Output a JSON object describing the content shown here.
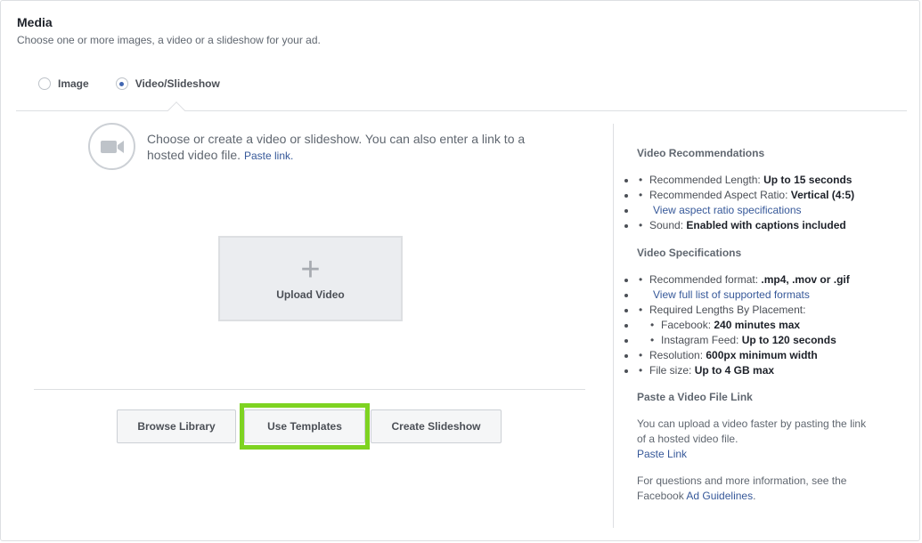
{
  "media": {
    "title": "Media",
    "subtitle": "Choose one or more images, a video or a slideshow for your ad."
  },
  "format_options": {
    "selected": "Video/Slideshow",
    "items": [
      {
        "label": "Image",
        "checked": false
      },
      {
        "label": "Video/Slideshow",
        "checked": true
      }
    ]
  },
  "video_panel": {
    "intro_text": "Choose or create a video or slideshow. You can also enter a link to a hosted video file.",
    "paste_link": "Paste link.",
    "upload_plus": "+",
    "upload_label": "Upload Video",
    "buttons": {
      "browse": "Browse Library",
      "templates": "Use Templates",
      "slideshow": "Create Slideshow"
    },
    "highlight_color": "#7ed321"
  },
  "sidebar": {
    "recommendations_heading": "Video Recommendations",
    "rec_length_label": "Recommended Length: ",
    "rec_length_value": "Up to 15 seconds",
    "rec_aspect_label": "Recommended Aspect Ratio: ",
    "rec_aspect_value": "Vertical (4:5)",
    "aspect_link": "View aspect ratio specifications",
    "sound_label": "Sound: ",
    "sound_value": "Enabled with captions included",
    "specs_heading": "Video Specifications",
    "format_label": "Recommended format: ",
    "format_value": ".mp4, .mov or .gif",
    "formats_link": "View full list of supported formats",
    "lengths_label": "Required Lengths By Placement:",
    "facebook_label": "Facebook: ",
    "facebook_value": "240 minutes max",
    "instagram_label": "Instagram Feed: ",
    "instagram_value": "Up to 120 seconds",
    "resolution_label": "Resolution: ",
    "resolution_value": "600px minimum width",
    "filesize_label": "File size: ",
    "filesize_value": "Up to 4 GB max",
    "paste_heading": "Paste a Video File Link",
    "paste_text": "You can upload a video faster by pasting the link of a hosted video file.",
    "paste_link": "Paste Link",
    "guidelines_text": "For questions and more information, see the Facebook ",
    "guidelines_link": "Ad Guidelines",
    "guidelines_end": "."
  },
  "colors": {
    "link": "#365899",
    "accent": "#4267b2",
    "border": "#dddfe2"
  },
  "icons": {
    "video": "video-camera-icon",
    "plus": "plus-icon"
  }
}
